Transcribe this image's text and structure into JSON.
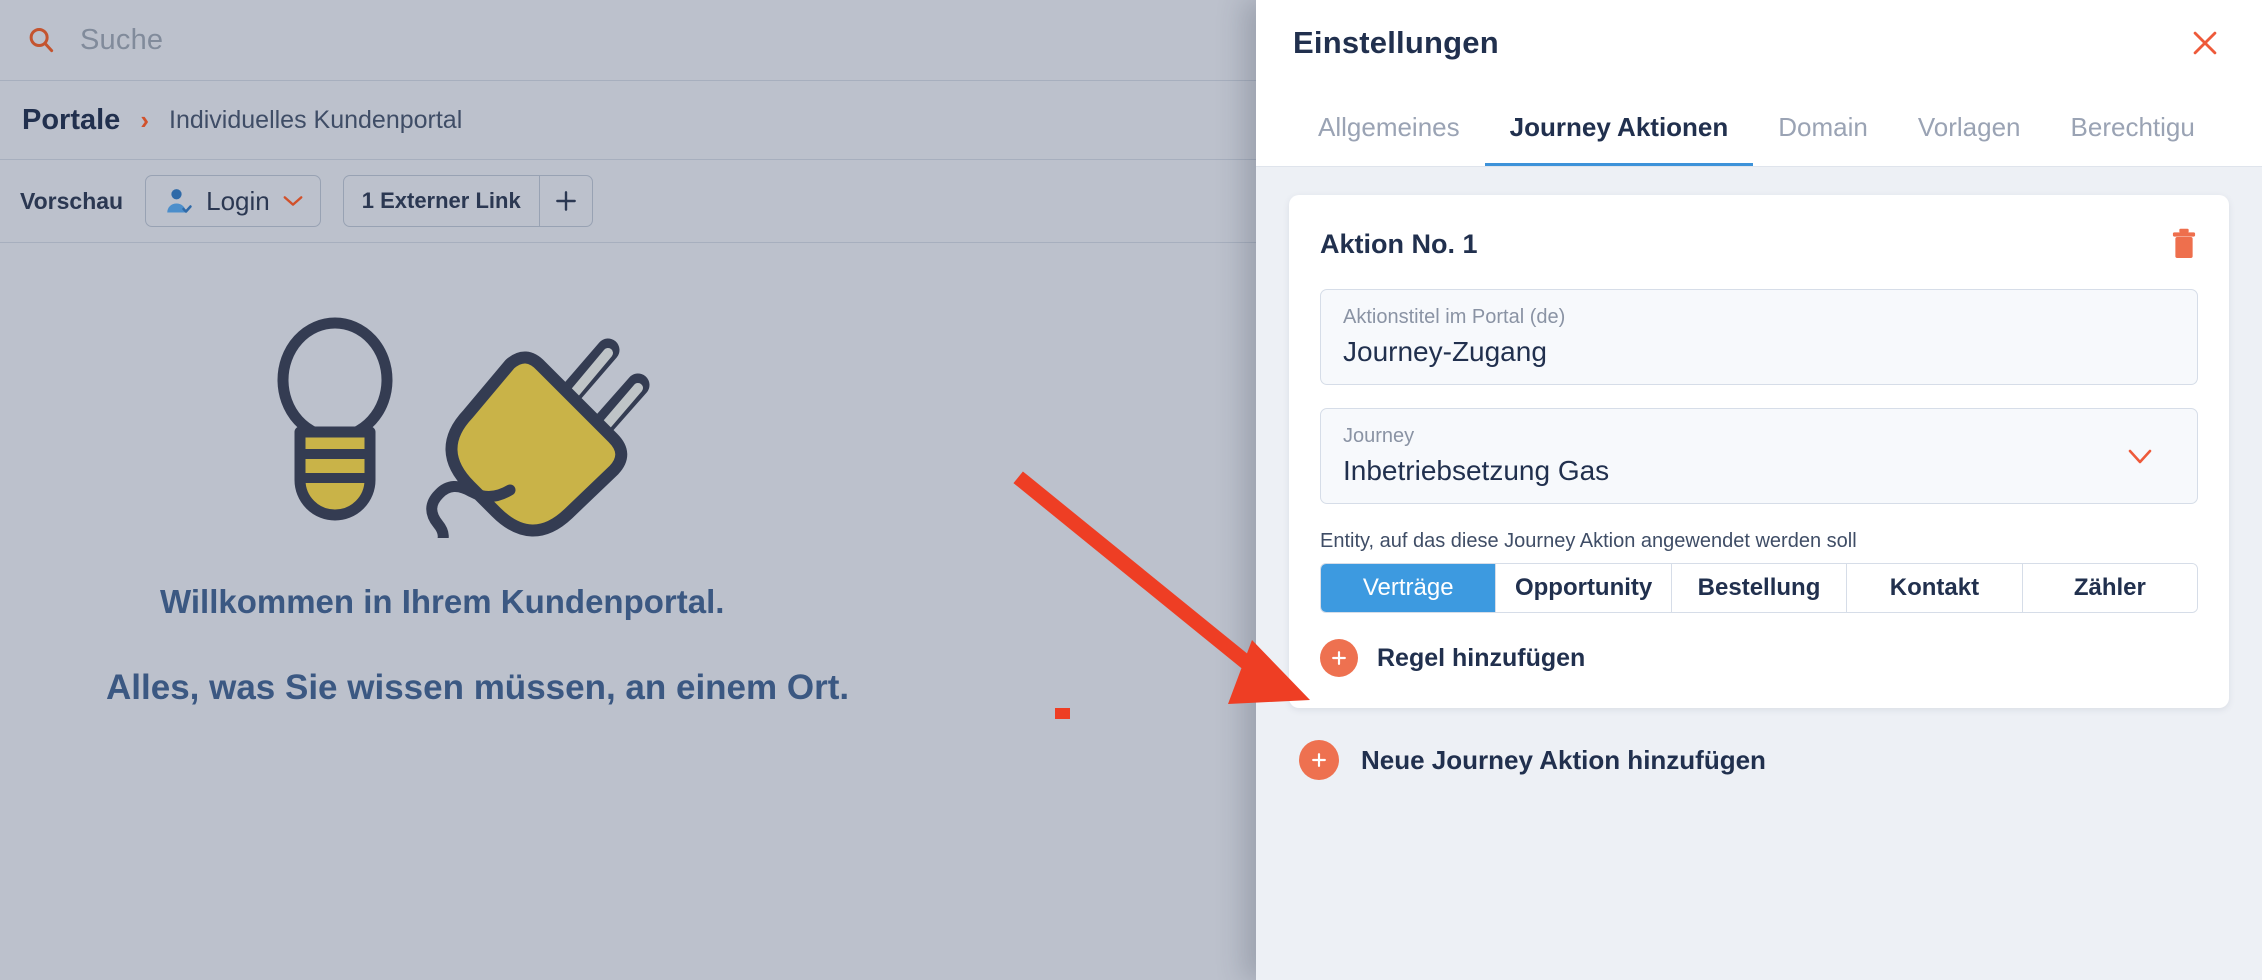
{
  "left": {
    "search": {
      "placeholder": "Suche",
      "icon": "search-icon"
    },
    "breadcrumb": {
      "root": "Portale",
      "separator": "›",
      "leaf": "Individuelles Kundenportal"
    },
    "toolbar": {
      "preview_label": "Vorschau",
      "login_label": "Login",
      "login_icon": "user-check-icon",
      "login_chevron": "chevron-down-icon",
      "external_link_label": "1 Externer Link",
      "add_icon": "plus-icon"
    },
    "preview": {
      "illustration": "lightbulb-and-plug-illustration",
      "heading": "Willkommen in Ihrem Kundenportal.",
      "subheading": "Alles, was Sie wissen müssen, an einem Ort."
    }
  },
  "drawer": {
    "title": "Einstellungen",
    "close_icon": "close-icon",
    "tabs": [
      {
        "label": "Allgemeines",
        "active": false
      },
      {
        "label": "Journey Aktionen",
        "active": true
      },
      {
        "label": "Domain",
        "active": false
      },
      {
        "label": "Vorlagen",
        "active": false
      },
      {
        "label": "Berechtigu",
        "active": false
      }
    ],
    "action_card": {
      "title": "Aktion No. 1",
      "delete_icon": "trash-icon",
      "title_field": {
        "label": "Aktionstitel im Portal (de)",
        "value": "Journey-Zugang"
      },
      "journey_field": {
        "label": "Journey",
        "value": "Inbetriebsetzung Gas",
        "chevron_icon": "chevron-down-icon"
      },
      "entity_label": "Entity, auf das diese Journey Aktion angewendet werden soll",
      "entities": [
        {
          "label": "Verträge",
          "active": true
        },
        {
          "label": "Opportunity",
          "active": false
        },
        {
          "label": "Bestellung",
          "active": false
        },
        {
          "label": "Kontakt",
          "active": false
        },
        {
          "label": "Zähler",
          "active": false
        }
      ],
      "add_rule_label": "Regel hinzufügen",
      "add_rule_icon": "plus-circle-icon"
    },
    "add_action_label": "Neue Journey Aktion hinzufügen",
    "add_action_icon": "plus-circle-icon"
  },
  "annotation": {
    "arrow": "red-arrow-pointing-to-add-rule",
    "marker": "red-square-marker",
    "color": "#ee3e24"
  },
  "colors": {
    "accent_orange": "#ee7150",
    "accent_blue": "#3d9ae0",
    "tab_underline": "#3d92d9",
    "text_dark": "#21304e",
    "page_bg": "#bcc1cc",
    "drawer_bg": "#edf0f5",
    "annotation_red": "#ee3e24"
  }
}
